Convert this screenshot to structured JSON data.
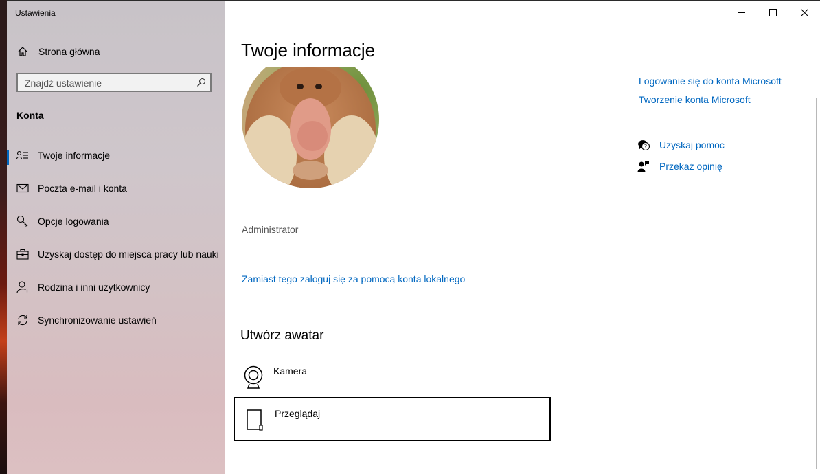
{
  "window": {
    "title": "Ustawienia"
  },
  "sidebar": {
    "home_label": "Strona główna",
    "search_placeholder": "Znajdź ustawienie",
    "section_title": "Konta",
    "items": [
      {
        "label": "Twoje informacje",
        "icon": "person-info-icon",
        "active": true
      },
      {
        "label": "Poczta e-mail i konta",
        "icon": "mail-icon"
      },
      {
        "label": "Opcje logowania",
        "icon": "key-icon"
      },
      {
        "label": "Uzyskaj dostęp do miejsca pracy lub nauki",
        "icon": "briefcase-icon"
      },
      {
        "label": "Rodzina i inni użytkownicy",
        "icon": "person-add-icon"
      },
      {
        "label": "Synchronizowanie ustawień",
        "icon": "sync-icon"
      }
    ]
  },
  "main": {
    "title": "Twoje informacje",
    "username": "Administrator",
    "local_account_link": "Zamiast tego zaloguj się za pomocą konta lokalnego",
    "avatar_section_title": "Utwórz awatar",
    "avatar_options": [
      {
        "label": "Kamera",
        "icon": "webcam-icon"
      },
      {
        "label": "Przeglądaj",
        "icon": "document-icon",
        "selected": true
      }
    ]
  },
  "related": {
    "links": [
      "Logowanie się do konta Microsoft",
      "Tworzenie konta Microsoft"
    ],
    "help": [
      {
        "label": "Uzyskaj pomoc",
        "icon": "help-chat-icon"
      },
      {
        "label": "Przekaż opinię",
        "icon": "feedback-icon"
      }
    ]
  },
  "colors": {
    "accent": "#0067c0",
    "sidebar_bg": "#d0c4c8"
  }
}
